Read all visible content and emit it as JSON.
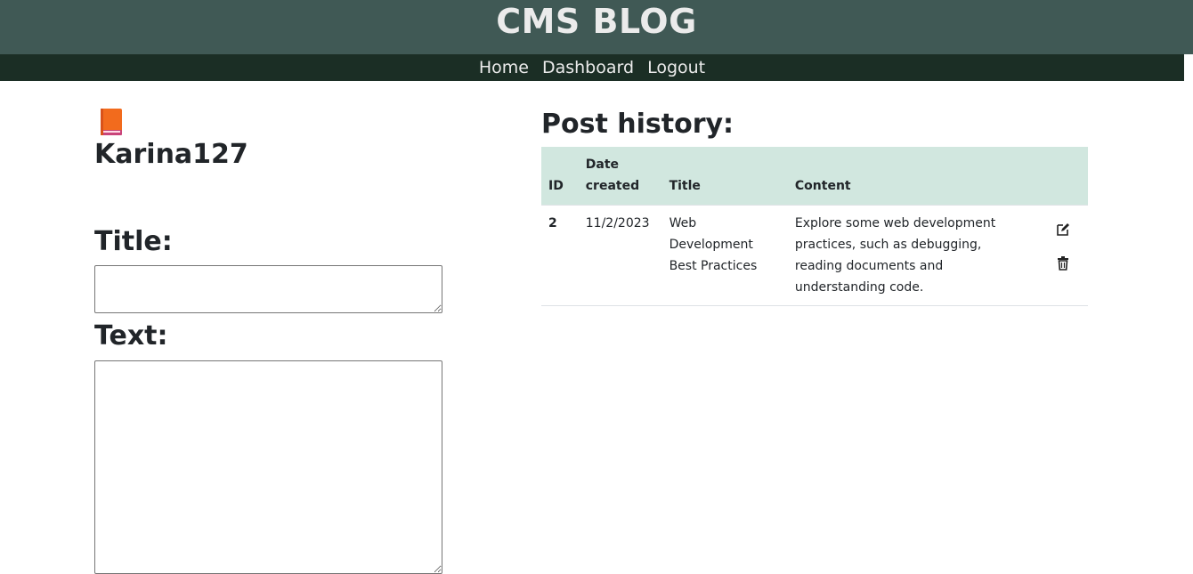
{
  "header": {
    "title": "CMS BLOG"
  },
  "nav": {
    "items": [
      "Home",
      "Dashboard",
      "Logout"
    ]
  },
  "profile": {
    "icon": "book-icon",
    "username": "Karina127"
  },
  "form": {
    "title_label": "Title:",
    "title_value": "",
    "text_label": "Text:",
    "text_value": ""
  },
  "history": {
    "heading": "Post history:",
    "columns": [
      "ID",
      "Date created",
      "Title",
      "Content"
    ],
    "rows": [
      {
        "id": "2",
        "date": "11/2/2023",
        "title": "Web Development Best Practices",
        "content": "Explore some web development practices, such as debugging, reading documents and understanding code.",
        "actions": [
          "edit-icon",
          "trash-icon"
        ]
      }
    ]
  },
  "colors": {
    "header_bg": "#405955",
    "nav_bg": "#1b2e25",
    "table_header_bg": "#d1e7df",
    "book_icon": "#f26b1d"
  }
}
